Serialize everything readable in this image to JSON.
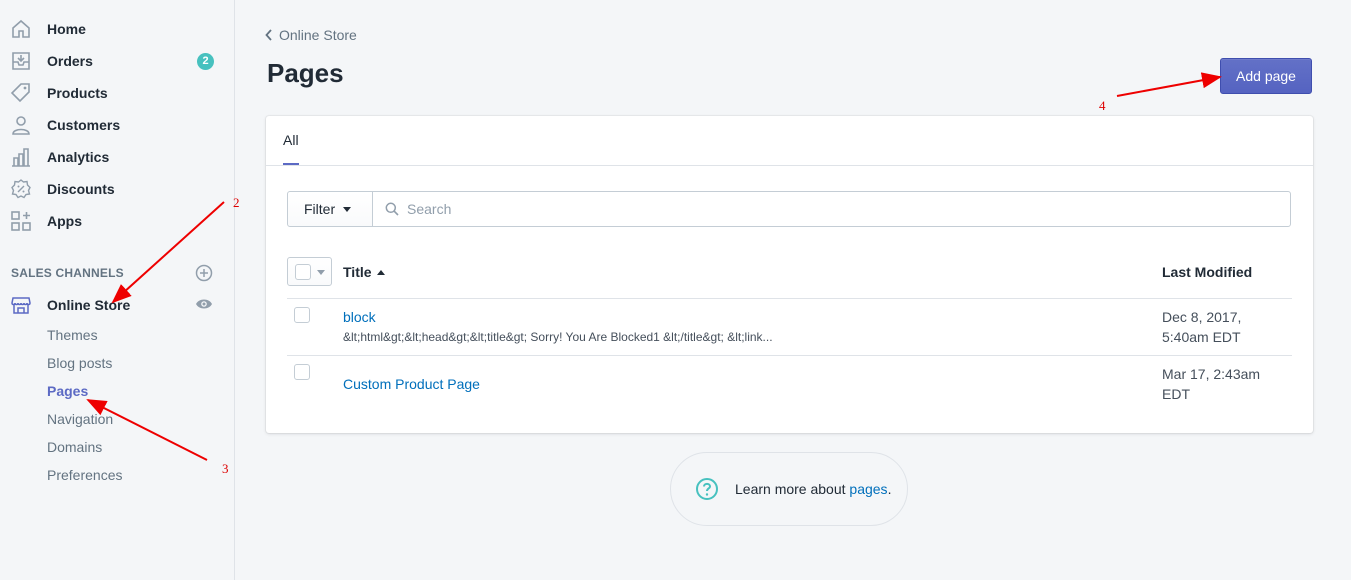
{
  "sidebar": {
    "nav": [
      {
        "label": "Home",
        "icon": "home-icon"
      },
      {
        "label": "Orders",
        "icon": "orders-icon",
        "badge": "2"
      },
      {
        "label": "Products",
        "icon": "tag-icon"
      },
      {
        "label": "Customers",
        "icon": "person-icon"
      },
      {
        "label": "Analytics",
        "icon": "bar-chart-icon"
      },
      {
        "label": "Discounts",
        "icon": "discount-icon"
      },
      {
        "label": "Apps",
        "icon": "apps-icon"
      }
    ],
    "sales_channels_title": "SALES CHANNELS",
    "channel": {
      "label": "Online Store",
      "icon": "store-icon"
    },
    "sub_items": [
      "Themes",
      "Blog posts",
      "Pages",
      "Navigation",
      "Domains",
      "Preferences"
    ],
    "active_sub_item": "Pages"
  },
  "header": {
    "breadcrumb": "Online Store",
    "title": "Pages",
    "add_button": "Add page"
  },
  "card": {
    "tab": "All",
    "filter_label": "Filter",
    "search_placeholder": "Search",
    "columns": {
      "title": "Title",
      "last_modified": "Last Modified"
    },
    "rows": [
      {
        "title": "block",
        "description": "&lt;html&gt;&lt;head&gt;&lt;title&gt; Sorry! You Are Blocked1 &lt;/title&gt; &lt;link...",
        "date_line1": "Dec 8, 2017,",
        "date_line2": "5:40am EDT"
      },
      {
        "title": "Custom Product Page",
        "description": "",
        "date_line1": "Mar 17, 2:43am",
        "date_line2": "EDT"
      }
    ]
  },
  "learn_more": {
    "prefix": "Learn more about ",
    "link": "pages",
    "suffix": "."
  },
  "annotations": [
    "2",
    "3",
    "4"
  ],
  "colors": {
    "accent": "#5c6ac4",
    "link": "#006fbb",
    "badge": "#47c1bf",
    "annotation": "#dd0000"
  }
}
